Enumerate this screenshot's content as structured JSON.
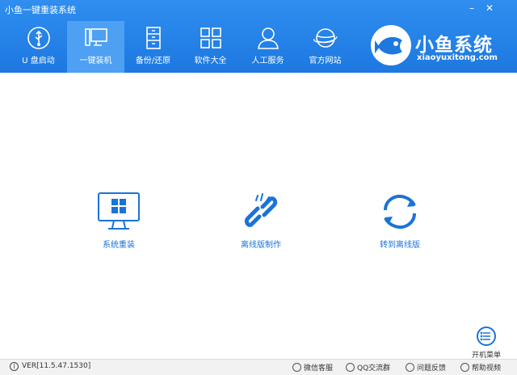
{
  "window": {
    "title": "小鱼一键重装系统"
  },
  "nav": {
    "items": [
      {
        "label": "U 盘启动",
        "icon": "usb-icon"
      },
      {
        "label": "一键装机",
        "icon": "monitor-icon"
      },
      {
        "label": "备份/还原",
        "icon": "cabinet-icon"
      },
      {
        "label": "软件大全",
        "icon": "grid-icon"
      },
      {
        "label": "人工服务",
        "icon": "person-icon"
      },
      {
        "label": "官方网站",
        "icon": "planet-icon"
      }
    ],
    "active": 1
  },
  "logo": {
    "title": "小鱼系统",
    "subtitle": "xiaoyuxitong.com"
  },
  "main": {
    "actions": [
      {
        "label": "系统重装",
        "icon": "windows-monitor-icon"
      },
      {
        "label": "离线版制作",
        "icon": "broken-link-icon"
      },
      {
        "label": "转到离线版",
        "icon": "refresh-icon"
      }
    ]
  },
  "boot_menu": {
    "label": "开机菜单"
  },
  "footer": {
    "version": "VER[11.5.47.1530]",
    "links": [
      "微信客服",
      "QQ交流群",
      "问题反馈",
      "帮助视频"
    ]
  },
  "colors": {
    "header": "#1d78e0",
    "active_tab": "#4ea0f2",
    "accent": "#1a73d9"
  }
}
